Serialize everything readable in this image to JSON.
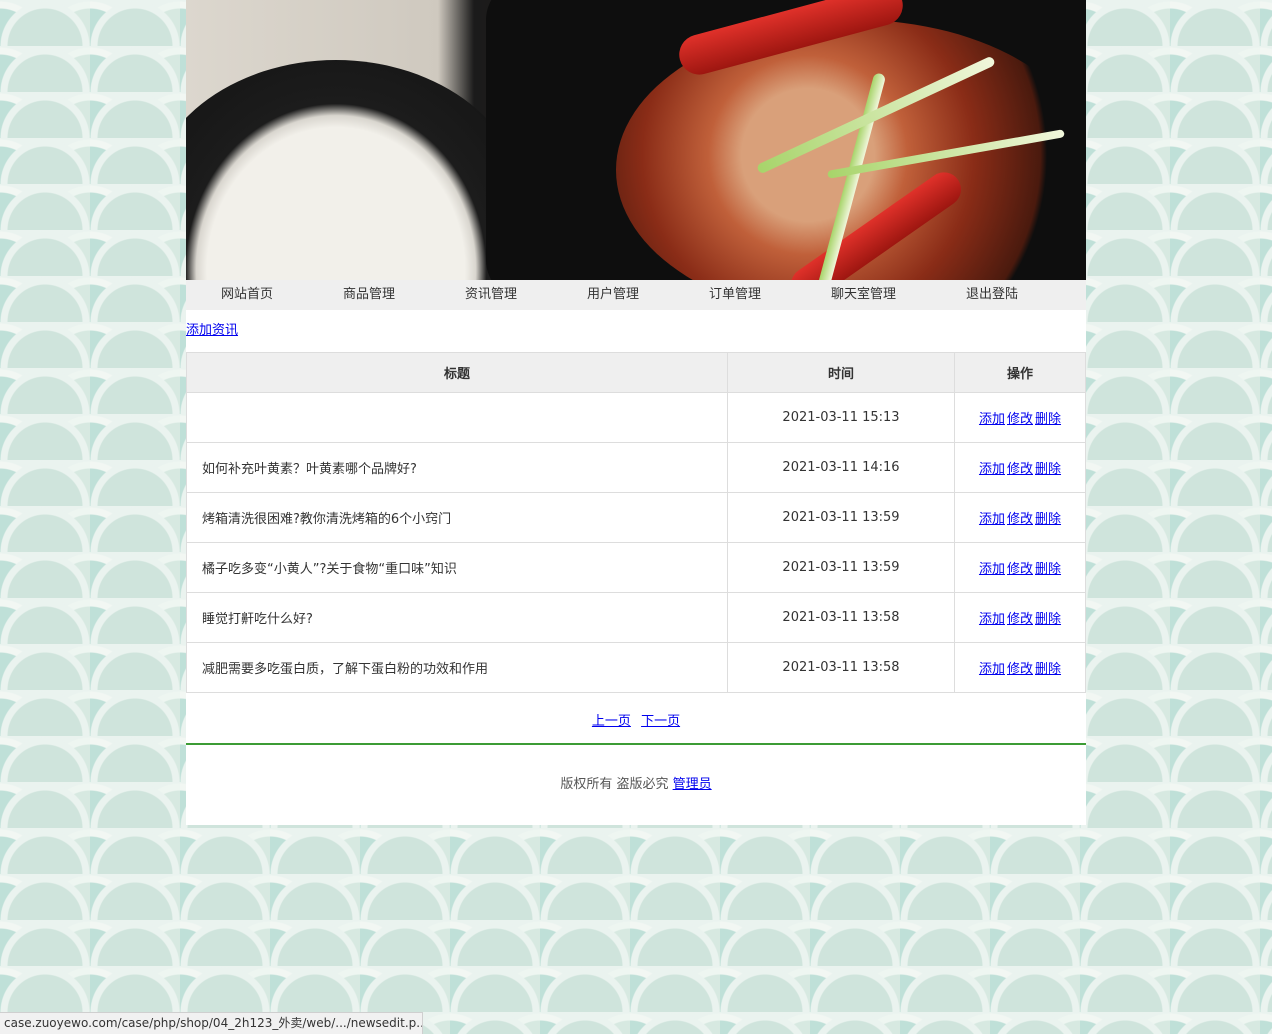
{
  "nav": {
    "items": [
      {
        "label": "网站首页",
        "width": 122
      },
      {
        "label": "商品管理",
        "width": 122
      },
      {
        "label": "资讯管理",
        "width": 122
      },
      {
        "label": "用户管理",
        "width": 122
      },
      {
        "label": "订单管理",
        "width": 122
      },
      {
        "label": "聊天室管理",
        "width": 135
      },
      {
        "label": "退出登陆",
        "width": 122
      }
    ]
  },
  "add_link": "添加资讯",
  "table": {
    "headers": [
      "标题",
      "时间",
      "操作"
    ],
    "rows": [
      {
        "title": "",
        "time": "2021-03-11 15:13"
      },
      {
        "title": "如何补充叶黄素？叶黄素哪个品牌好?",
        "time": "2021-03-11 14:16"
      },
      {
        "title": "烤箱清洗很困难?教你清洗烤箱的6个小窍门",
        "time": "2021-03-11 13:59"
      },
      {
        "title": "橘子吃多变“小黄人”?关于食物“重口味”知识",
        "time": "2021-03-11 13:59"
      },
      {
        "title": "睡觉打鼾吃什么好?",
        "time": "2021-03-11 13:58"
      },
      {
        "title": "减肥需要多吃蛋白质，了解下蛋白粉的功效和作用",
        "time": "2021-03-11 13:58"
      }
    ],
    "ops": {
      "add": "添加",
      "edit": "修改",
      "delete": "删除"
    }
  },
  "pager": {
    "prev": "上一页",
    "next": "下一页"
  },
  "footer": {
    "text": "版权所有 盗版必究",
    "link": "管理员"
  },
  "status_bar": "case.zuoyewo.com/case/php/shop/04_2h123_外卖/web/.../newsedit.p..."
}
